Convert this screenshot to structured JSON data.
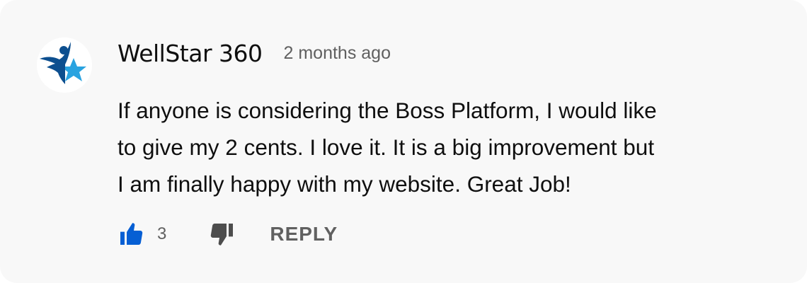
{
  "comment": {
    "author": "WellStar 360",
    "timestamp": "2 months ago",
    "avatar_icon": "star-person-logo-icon",
    "text": "If anyone is considering the Boss Platform, I would like\nto give my 2 cents. I love it. It is a big improvement but\nI am finally happy with my website. Great Job!",
    "like_count": "3",
    "like_icon": "thumbs-up-icon",
    "dislike_icon": "thumbs-down-icon",
    "reply_label": "REPLY"
  },
  "colors": {
    "card_background": "#f8f8f8",
    "text_primary": "#0f0f0f",
    "text_secondary": "#606060",
    "like_active": "#065fd4",
    "dislike": "#4d4d4d",
    "avatar_dark_blue": "#0d4f8f",
    "avatar_light_blue": "#29a3e0"
  }
}
